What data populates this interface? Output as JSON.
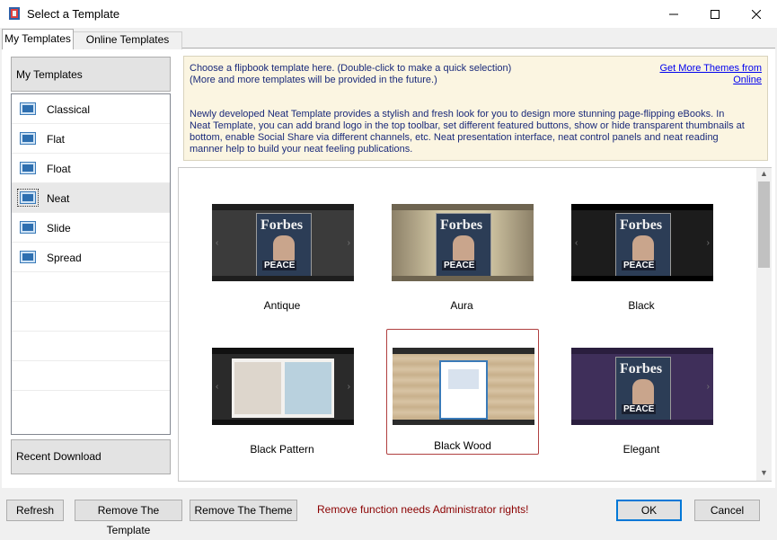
{
  "window": {
    "title": "Select a Template"
  },
  "tabs": [
    {
      "label": "My Templates"
    },
    {
      "label": "Online Templates"
    }
  ],
  "sidebar": {
    "header": "My Templates",
    "items": [
      {
        "label": "Classical"
      },
      {
        "label": "Flat"
      },
      {
        "label": "Float"
      },
      {
        "label": "Neat"
      },
      {
        "label": "Slide"
      },
      {
        "label": "Spread"
      }
    ],
    "selected": "Neat",
    "footer": "Recent Download"
  },
  "info": {
    "line1": "Choose a flipbook template here. (Double-click to make a quick selection)",
    "line2": "(More and more templates will be provided in the future.)",
    "paragraph": "Newly developed Neat Template provides a stylish and fresh look for you to design more stunning page-flipping eBooks. In Neat Template, you can add brand logo in the top toolbar, set different featured buttons, show or hide transparent thumbnails at bottom, enable Social Share via different channels, etc. Neat presentation interface, neat control panels and neat reading manner help to build your neat feeling publications.",
    "link": "Get More Themes from Online"
  },
  "templates": [
    {
      "label": "Antique",
      "bg": "#3b3b3b"
    },
    {
      "label": "Aura",
      "bg": "#b8a98a"
    },
    {
      "label": "Black",
      "bg": "#1c1c1c"
    },
    {
      "label": "Black Pattern",
      "bg": "#2a2a2a"
    },
    {
      "label": "Black Wood",
      "bg": "#cfb998"
    },
    {
      "label": "Elegant",
      "bg": "#3f2f5a"
    }
  ],
  "cover": {
    "masthead": "Forbes",
    "headline": "PEACE"
  },
  "selected_template": "Black Wood",
  "footer": {
    "refresh": "Refresh",
    "remove_template": "Remove The Template",
    "remove_theme": "Remove The Theme",
    "warning": "Remove function needs Administrator rights!",
    "ok": "OK",
    "cancel": "Cancel"
  },
  "colors": {
    "accent": "#0078d7",
    "warning": "#8b0000",
    "link": "#0000ee",
    "info_bg": "#fbf5e1"
  }
}
